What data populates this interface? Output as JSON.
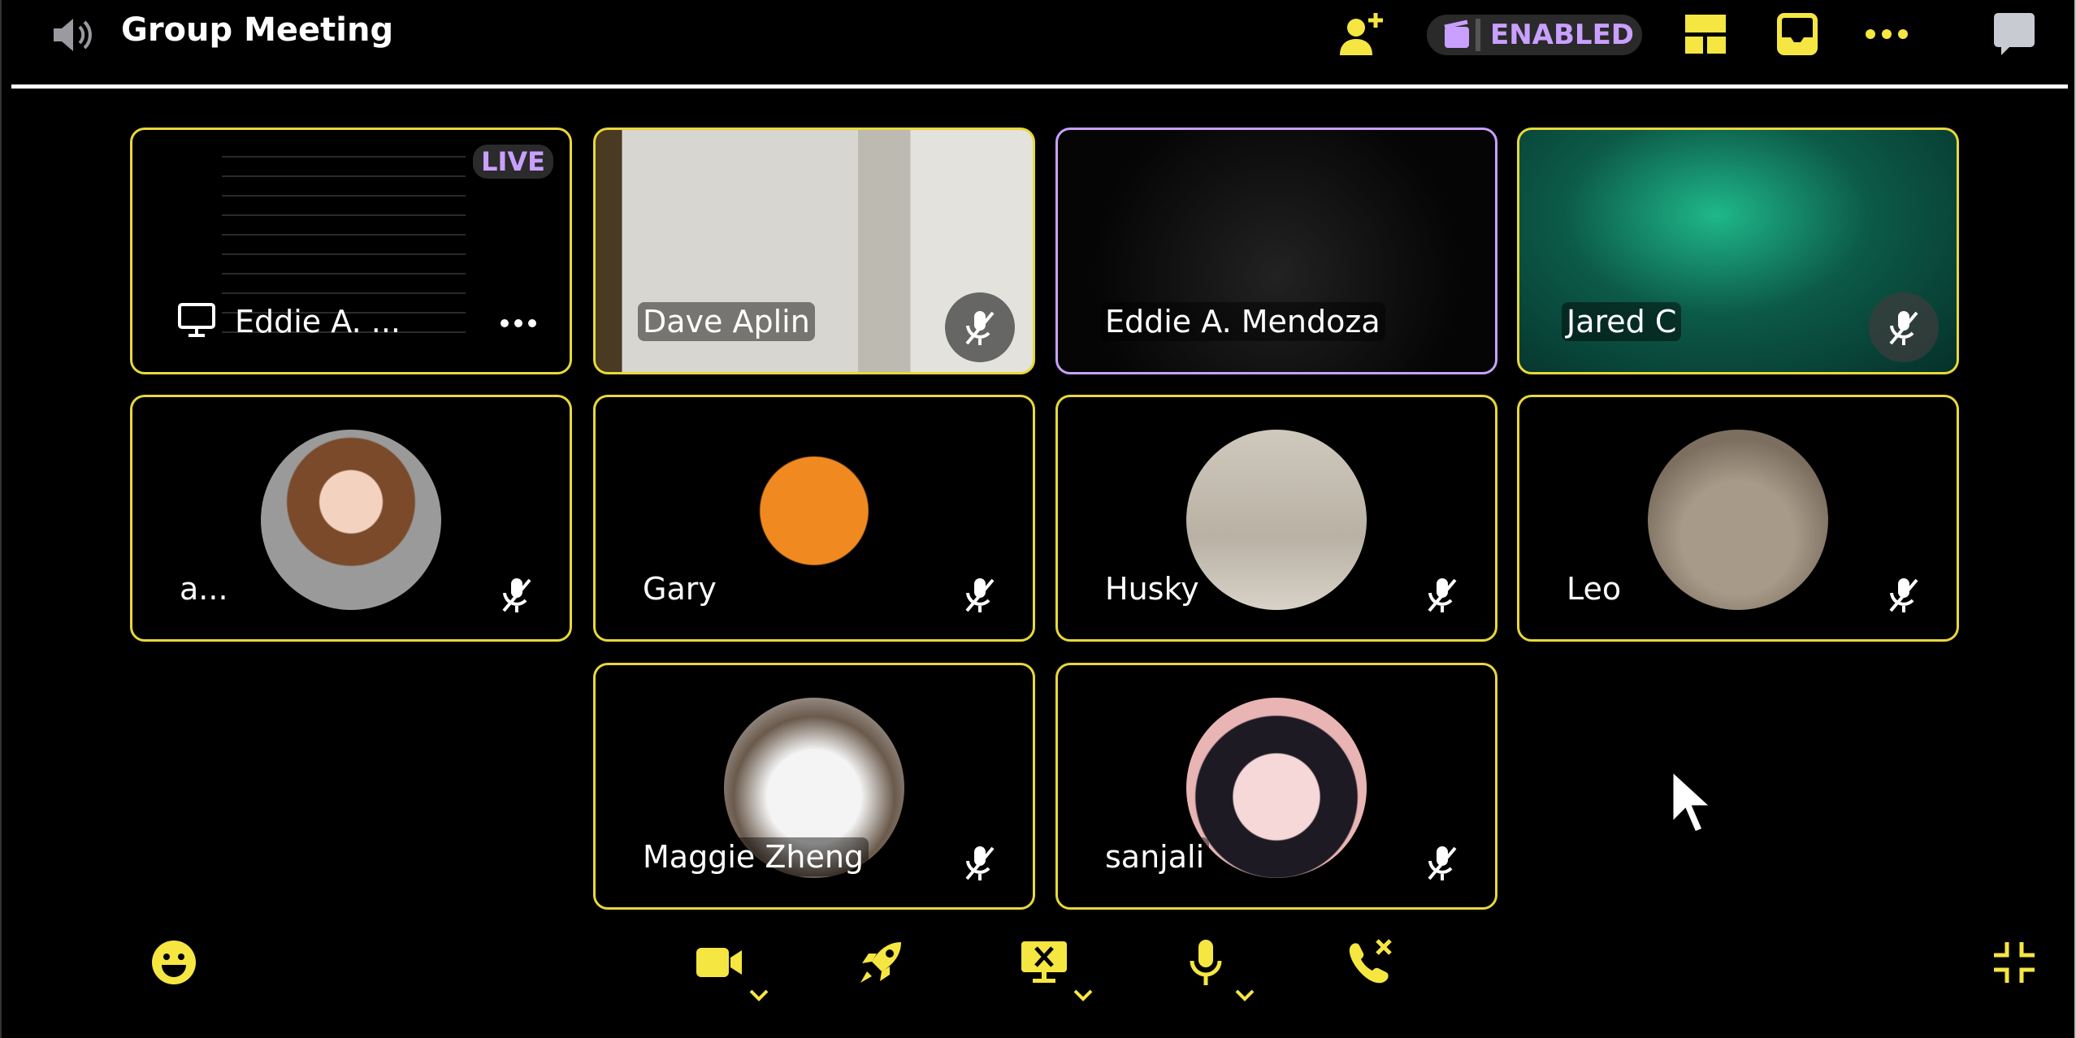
{
  "header": {
    "title": "Group Meeting",
    "icons": [
      "speaker-icon",
      "add-user-icon",
      "clapper-icon",
      "layout-icon",
      "inbox-icon",
      "more-icon",
      "chat-icon"
    ],
    "activity_status": "ENABLED"
  },
  "colors": {
    "accent": "#f5e642",
    "speaking": "#c9a0ff",
    "background": "#000000"
  },
  "tiles": [
    {
      "name": "Eddie A. ...",
      "type": "screenshare",
      "live_label": "LIVE",
      "icon": "monitor-icon",
      "menu": "more-icon"
    },
    {
      "name": "Dave Aplin",
      "type": "video",
      "muted": true,
      "scene": "office"
    },
    {
      "name": "Eddie A. Mendoza",
      "type": "video",
      "muted": false,
      "speaking": true,
      "scene": "camera-bg"
    },
    {
      "name": "Jared C",
      "type": "video",
      "muted": true,
      "scene": "green"
    },
    {
      "name": "a...",
      "type": "avatar",
      "muted": true,
      "avatar": "girl"
    },
    {
      "name": "Gary",
      "type": "avatar",
      "muted": true,
      "avatar": "monkey"
    },
    {
      "name": "Husky",
      "type": "avatar",
      "muted": true,
      "avatar": "heron"
    },
    {
      "name": "Leo",
      "type": "avatar",
      "muted": true,
      "avatar": "cat"
    },
    {
      "name": "Maggie Zheng",
      "type": "avatar",
      "muted": true,
      "avatar": "crying-cat"
    },
    {
      "name": "sanjali",
      "type": "avatar",
      "muted": true,
      "avatar": "anime"
    }
  ],
  "toolbar": {
    "icons": [
      "emoji-icon",
      "camera-icon",
      "rocket-icon",
      "stop-share-icon",
      "microphone-icon",
      "leave-call-icon",
      "exit-fullscreen-icon"
    ]
  }
}
